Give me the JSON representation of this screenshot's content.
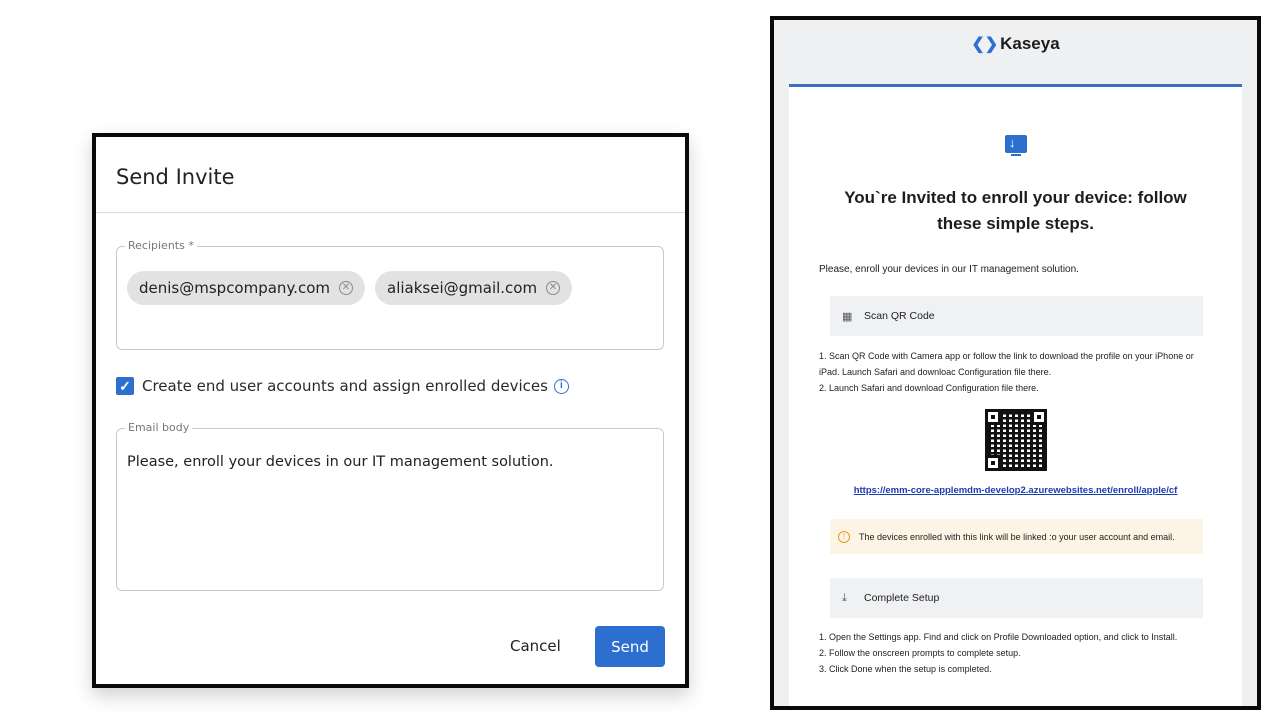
{
  "dialog": {
    "title": "Send Invite",
    "recipients_label": "Recipients *",
    "recipients": [
      {
        "email": "denis@mspcompany.com"
      },
      {
        "email": "aliaksei@gmail.com"
      }
    ],
    "create_accounts_label": "Create end user accounts and assign enrolled devices",
    "create_accounts_checked": true,
    "email_body_label": "Email body",
    "email_body_value": "Please, enroll your devices in our IT management solution.",
    "cancel_label": "Cancel",
    "send_label": "Send",
    "accent_color": "#2d6fcf"
  },
  "email_preview": {
    "brand": "Kaseya",
    "heading_line1": "You`re Invited to enroll your device: follow",
    "heading_line2": "these simple steps.",
    "intro": "Please, enroll your devices in our IT management solution.",
    "qr_section": {
      "title": "Scan QR Code",
      "icon": "qr-grid-icon",
      "steps": [
        "1. Scan QR Code with Camera app or follow the link to download the profile on your iPhone or iPad. Launch Safari and downloac Configuration file there.",
        "2. Launch Safari and download Configuration file there."
      ],
      "link": "https://emm-core-applemdm-develop2.azurewebsites.net/enroll/apple/cf"
    },
    "warning": "The devices enrolled with this link will be linked :o your user account and email.",
    "setup_section": {
      "title": "Complete Setup",
      "icon": "download-arrow-icon",
      "steps": [
        "1. Open the Settings app. Find and click on Profile Downloaded option, and click to Install.",
        "2. Follow the onscreen prompts to complete setup.",
        "3. Click Done when the setup is completed."
      ]
    },
    "rule_color": "#3a6fc4"
  }
}
